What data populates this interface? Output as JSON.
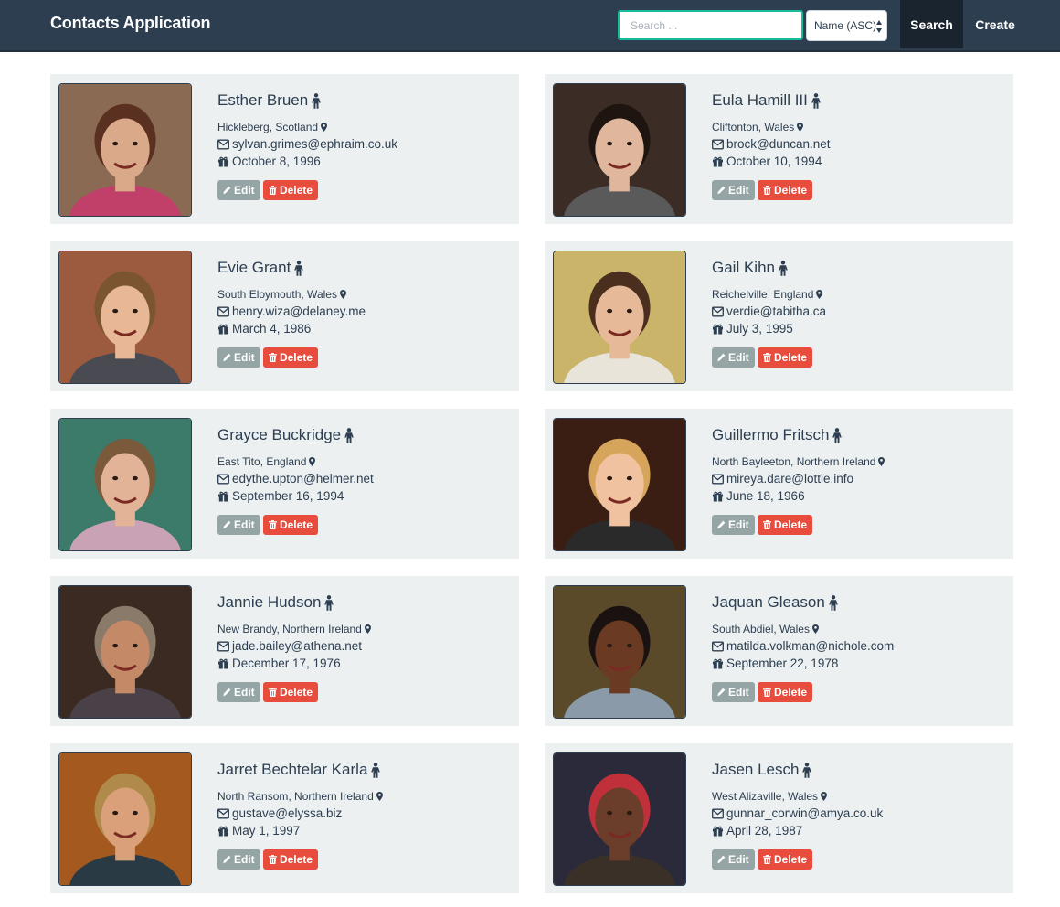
{
  "app": {
    "title": "Contacts Application"
  },
  "toolbar": {
    "search_placeholder": "Search ...",
    "sort_value": "Name (ASC)",
    "search_label": "Search",
    "create_label": "Create"
  },
  "actions": {
    "edit_label": "Edit",
    "delete_label": "Delete"
  },
  "colors": {
    "navbar": "#2c3e50",
    "accent": "#18bc9c",
    "edit": "#95a5a6",
    "delete": "#e74c3c",
    "card": "#ecf0f1"
  },
  "icons": {
    "gender": "person-icon",
    "location": "map-marker-icon",
    "email": "envelope-icon",
    "birthday": "gift-icon",
    "edit": "pencil-icon",
    "delete": "trash-icon"
  },
  "contacts": [
    {
      "name": "Esther Bruen",
      "location": "Hickleberg, Scotland",
      "email": "sylvan.grimes@ephraim.co.uk",
      "dob": "October 8, 1996"
    },
    {
      "name": "Eula Hamill III",
      "location": "Cliftonton, Wales",
      "email": "brock@duncan.net",
      "dob": "October 10, 1994"
    },
    {
      "name": "Evie Grant",
      "location": "South Eloymouth, Wales",
      "email": "henry.wiza@delaney.me",
      "dob": "March 4, 1986"
    },
    {
      "name": "Gail Kihn",
      "location": "Reichelville, England",
      "email": "verdie@tabitha.ca",
      "dob": "July 3, 1995"
    },
    {
      "name": "Grayce Buckridge",
      "location": "East Tito, England",
      "email": "edythe.upton@helmer.net",
      "dob": "September 16, 1994"
    },
    {
      "name": "Guillermo Fritsch",
      "location": "North Bayleeton, Northern Ireland",
      "email": "mireya.dare@lottie.info",
      "dob": "June 18, 1966"
    },
    {
      "name": "Jannie Hudson",
      "location": "New Brandy, Northern Ireland",
      "email": "jade.bailey@athena.net",
      "dob": "December 17, 1976"
    },
    {
      "name": "Jaquan Gleason",
      "location": "South Abdiel, Wales",
      "email": "matilda.volkman@nichole.com",
      "dob": "September 22, 1978"
    },
    {
      "name": "Jarret Bechtelar Karla",
      "location": "North Ransom, Northern Ireland",
      "email": "gustave@elyssa.biz",
      "dob": "May 1, 1997"
    },
    {
      "name": "Jasen Lesch",
      "location": "West Alizaville, Wales",
      "email": "gunnar_corwin@amya.co.uk",
      "dob": "April 28, 1987"
    }
  ]
}
